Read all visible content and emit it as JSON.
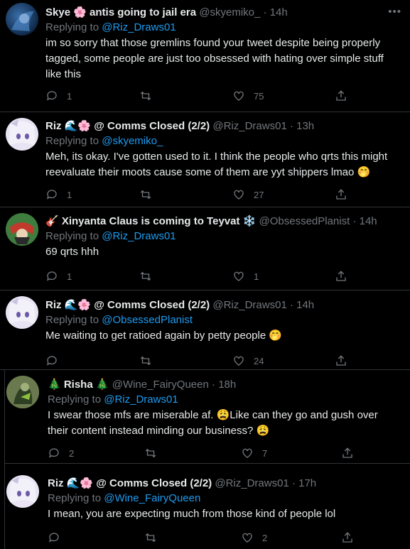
{
  "tweets": [
    {
      "name": "Skye 🌸 antis going to jail era",
      "handle": "@skyemiko_",
      "time": "14h",
      "reply_prefix": "Replying to ",
      "reply_to": "@Riz_Draws01",
      "text": "im so sorry that those gremlins found your tweet despite being properly tagged, some people are just too obsessed with hating over simple stuff like this",
      "replies": "1",
      "retweets": "",
      "likes": "75"
    },
    {
      "name": "Riz 🌊🌸 @ Comms Closed (2/2)",
      "handle": "@Riz_Draws01",
      "time": "13h",
      "reply_prefix": "Replying to ",
      "reply_to": "@skyemiko_",
      "text": "Meh, its okay. I've gotten used to it. I think the people who qrts this might reevaluate their moots cause some of them are yyt shippers lmao 🤭",
      "replies": "1",
      "retweets": "",
      "likes": "27"
    },
    {
      "name": "🎸 Xinyanta Claus is coming to Teyvat ❄️",
      "handle": "@ObsessedPlanist",
      "time": "14h",
      "reply_prefix": "Replying to ",
      "reply_to": "@Riz_Draws01",
      "text": "69 qrts hhh",
      "replies": "1",
      "retweets": "",
      "likes": "1"
    },
    {
      "name": "Riz 🌊🌸 @ Comms Closed (2/2)",
      "handle": "@Riz_Draws01",
      "time": "14h",
      "reply_prefix": "Replying to ",
      "reply_to": "@ObsessedPlanist",
      "text": "Me waiting to get ratioed again by petty people 🤭",
      "replies": "",
      "retweets": "",
      "likes": "24"
    },
    {
      "name": "🎄 Risha 🎄",
      "handle": "@Wine_FairyQueen",
      "time": "18h",
      "reply_prefix": "Replying to ",
      "reply_to": "@Riz_Draws01",
      "text": "I swear those mfs are miserable af. 😩Like can they go and gush over their content instead minding our business? 😩",
      "replies": "2",
      "retweets": "",
      "likes": "7"
    },
    {
      "name": "Riz 🌊🌸 @ Comms Closed (2/2)",
      "handle": "@Riz_Draws01",
      "time": "17h",
      "reply_prefix": "Replying to ",
      "reply_to": "@Wine_FairyQueen",
      "text": "I mean, you are expecting much from those kind of people lol",
      "replies": "",
      "retweets": "",
      "likes": "2"
    }
  ],
  "dot": "·",
  "icons": [
    "reply-icon",
    "retweet-icon",
    "like-icon",
    "share-icon",
    "more-icon"
  ],
  "colors": {
    "background": "#000000",
    "text": "#e7e9ea",
    "muted": "#71767b",
    "link": "#1d9bf0"
  }
}
